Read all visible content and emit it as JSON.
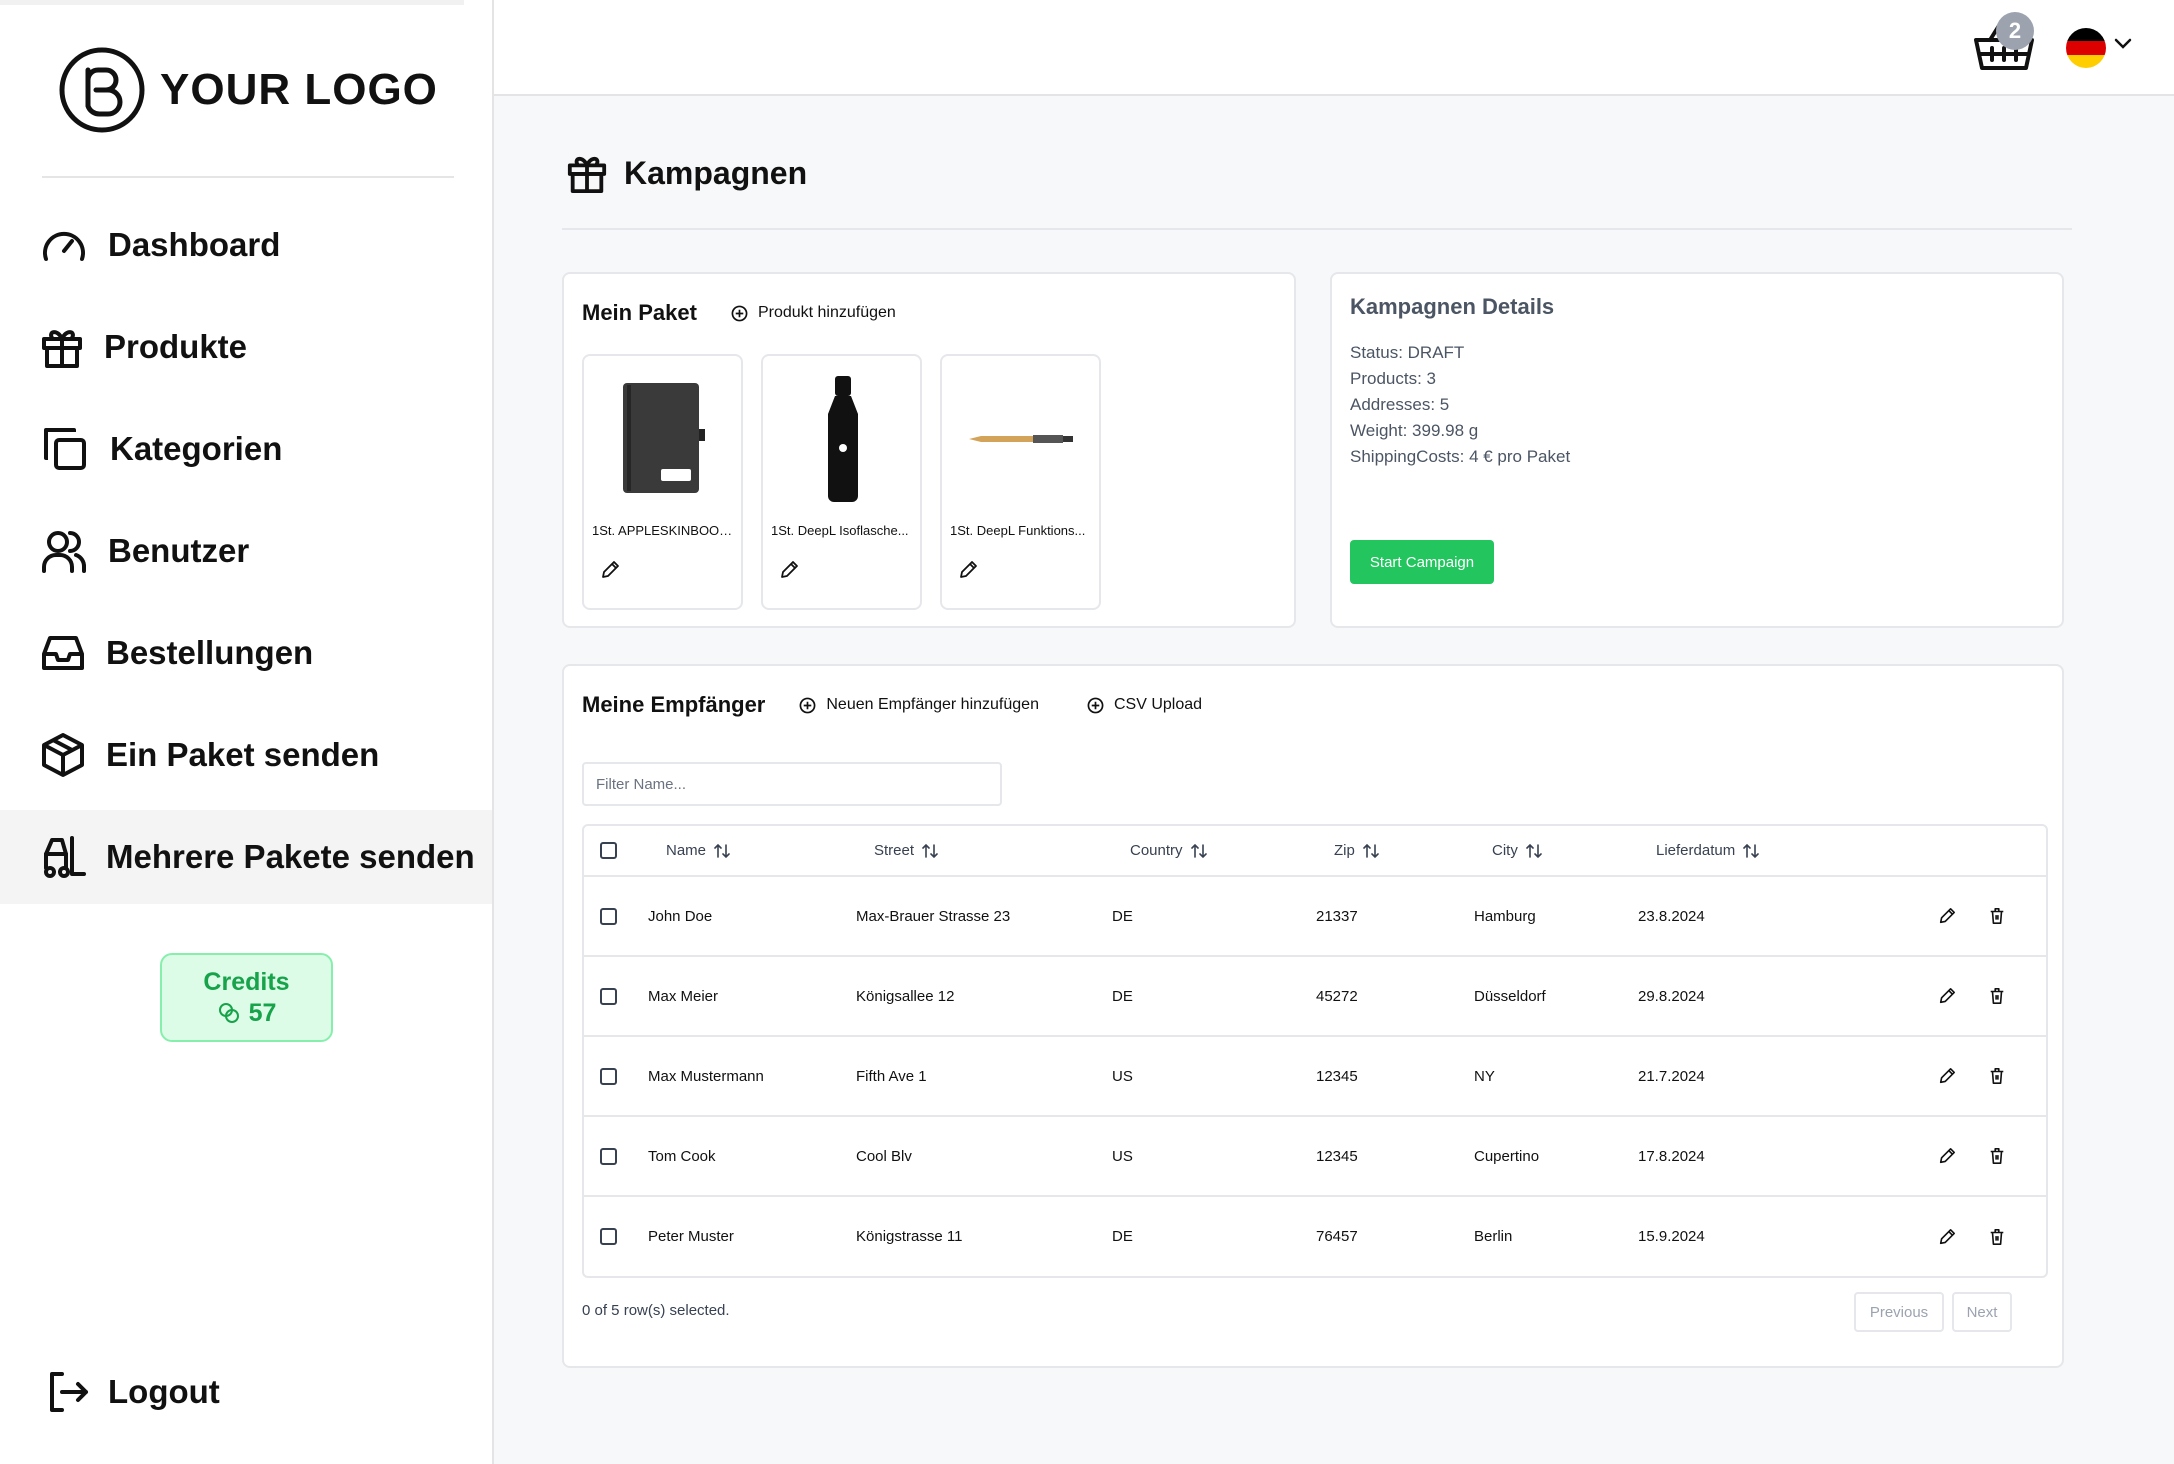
{
  "logo": {
    "text": "YOUR LOGO"
  },
  "sidebar": {
    "items": [
      {
        "label": "Dashboard",
        "icon": "gauge-icon"
      },
      {
        "label": "Produkte",
        "icon": "gift-icon"
      },
      {
        "label": "Kategorien",
        "icon": "copy-icon"
      },
      {
        "label": "Benutzer",
        "icon": "users-icon"
      },
      {
        "label": "Bestellungen",
        "icon": "inbox-icon"
      },
      {
        "label": "Ein Paket senden",
        "icon": "package-icon"
      },
      {
        "label": "Mehrere Pakete senden",
        "icon": "forklift-icon",
        "active": true
      }
    ],
    "credits": {
      "title": "Credits",
      "value": "57"
    },
    "logout": "Logout"
  },
  "topbar": {
    "cart_count": "2",
    "language": "de",
    "flag_colors": [
      "#000000",
      "#DD0000",
      "#FFCE00"
    ]
  },
  "page": {
    "title": "Kampagnen"
  },
  "paket": {
    "title": "Mein Paket",
    "add_label": "Produkt hinzufügen",
    "products": [
      {
        "name": "1St. APPLESKINBOOK..."
      },
      {
        "name": "1St. DeepL Isoflasche..."
      },
      {
        "name": "1St. DeepL Funktions..."
      }
    ]
  },
  "details": {
    "title": "Kampagnen Details",
    "status": "Status: DRAFT",
    "products": "Products: 3",
    "addresses": "Addresses: 5",
    "weight": "Weight: 399.98 g",
    "shipping": "ShippingCosts: 4 € pro Paket",
    "start_label": "Start Campaign",
    "accent": "#22c55e"
  },
  "recipients": {
    "title": "Meine Empfänger",
    "add_label": "Neuen Empfänger hinzufügen",
    "csv_label": "CSV Upload",
    "filter_placeholder": "Filter Name...",
    "columns": {
      "name": "Name",
      "street": "Street",
      "country": "Country",
      "zip": "Zip",
      "city": "City",
      "date": "Lieferdatum"
    },
    "rows": [
      {
        "name": "John Doe",
        "street": "Max-Brauer Strasse 23",
        "country": "DE",
        "zip": "21337",
        "city": "Hamburg",
        "date": "23.8.2024"
      },
      {
        "name": "Max Meier",
        "street": "Königsallee 12",
        "country": "DE",
        "zip": "45272",
        "city": "Düsseldorf",
        "date": "29.8.2024"
      },
      {
        "name": "Max Mustermann",
        "street": "Fifth Ave 1",
        "country": "US",
        "zip": "12345",
        "city": "NY",
        "date": "21.7.2024"
      },
      {
        "name": "Tom Cook",
        "street": "Cool Blv",
        "country": "US",
        "zip": "12345",
        "city": "Cupertino",
        "date": "17.8.2024"
      },
      {
        "name": "Peter Muster",
        "street": "Königstrasse 11",
        "country": "DE",
        "zip": "76457",
        "city": "Berlin",
        "date": "15.9.2024"
      }
    ],
    "selection": "0 of 5 row(s) selected.",
    "previous": "Previous",
    "next": "Next"
  }
}
